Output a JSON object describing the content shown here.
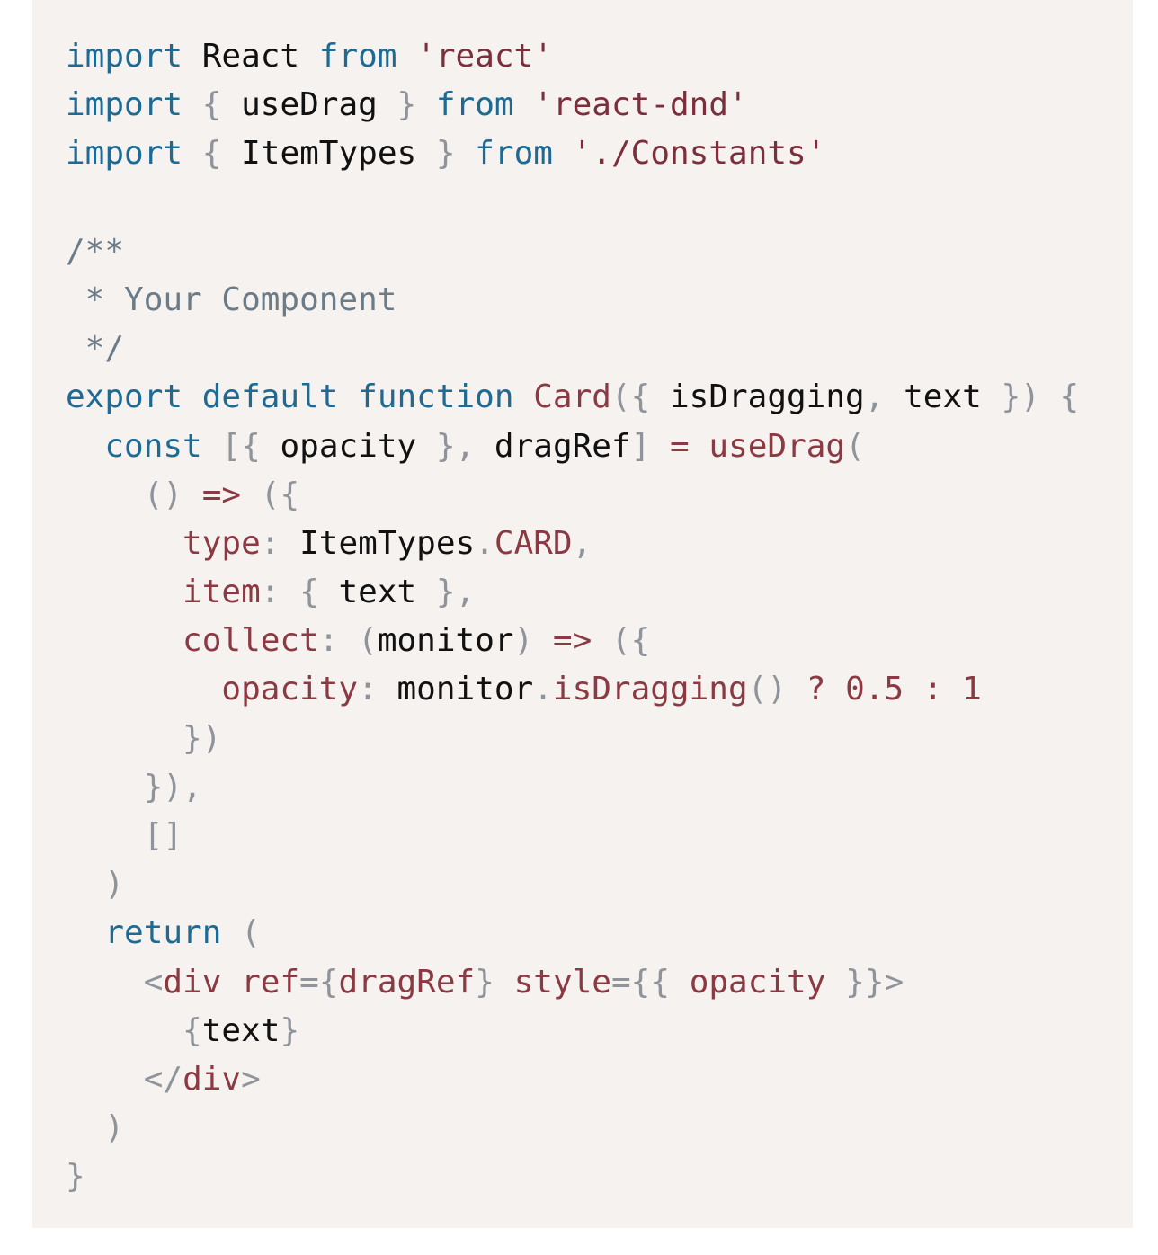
{
  "code": {
    "imports": [
      {
        "kw1": "import",
        "open": "",
        "name": "React",
        "close": "",
        "kw2": "from",
        "source": "'react'"
      },
      {
        "kw1": "import",
        "open": "{",
        "name": "useDrag",
        "close": "}",
        "kw2": "from",
        "source": "'react-dnd'"
      },
      {
        "kw1": "import",
        "open": "{",
        "name": "ItemTypes",
        "close": "}",
        "kw2": "from",
        "source": "'./Constants'"
      }
    ],
    "comment": {
      "open": "/**",
      "body": " * Your Component",
      "close": " */"
    },
    "signature": {
      "kw_export": "export",
      "kw_default": "default",
      "kw_function": "function",
      "fn_name": "Card",
      "paren_open": "({",
      "param1": "isDragging",
      "comma": ",",
      "param2": "text",
      "paren_close": "})",
      "brace": "{"
    },
    "hook_line": {
      "kw_const": "const",
      "open": "[{",
      "var1": "opacity",
      "mid": "},",
      "var2": "dragRef",
      "close": "]",
      "eq": "=",
      "call": "useDrag",
      "paren": "("
    },
    "arrow_line": {
      "parens": "()",
      "arrow": "=>",
      "open": "({"
    },
    "type_line": {
      "key": "type",
      "colon": ":",
      "obj": "ItemTypes",
      "dot": ".",
      "member": "CARD",
      "comma": ","
    },
    "item_line": {
      "key": "item",
      "colon": ":",
      "open": "{",
      "val": "text",
      "close": "},"
    },
    "collect_line": {
      "key": "collect",
      "colon": ":",
      "popen": "(",
      "param": "monitor",
      "pclose": ")",
      "arrow": "=>",
      "open": "({"
    },
    "opacity_line": {
      "key": "opacity",
      "colon": ":",
      "obj": "monitor",
      "dot": ".",
      "method": "isDragging",
      "call": "()",
      "q": "?",
      "v1": "0.5",
      "c": ":",
      "v2": "1"
    },
    "close_inner": "})",
    "close_outer": "}),",
    "deps": "[]",
    "close_call": ")",
    "return_line": {
      "kw": "return",
      "paren": "("
    },
    "jsx_open": {
      "lt": "<",
      "tag": "div",
      "attr1": "ref",
      "eq1": "={",
      "val1": "dragRef",
      "close1": "}",
      "attr2": "style",
      "eq2": "={{",
      "val2": "opacity",
      "close2": "}}",
      "gt": ">"
    },
    "jsx_child": {
      "open": "{",
      "val": "text",
      "close": "}"
    },
    "jsx_close": {
      "lt": "</",
      "tag": "div",
      "gt": ">"
    },
    "close_return": ")",
    "close_fn": "}"
  }
}
